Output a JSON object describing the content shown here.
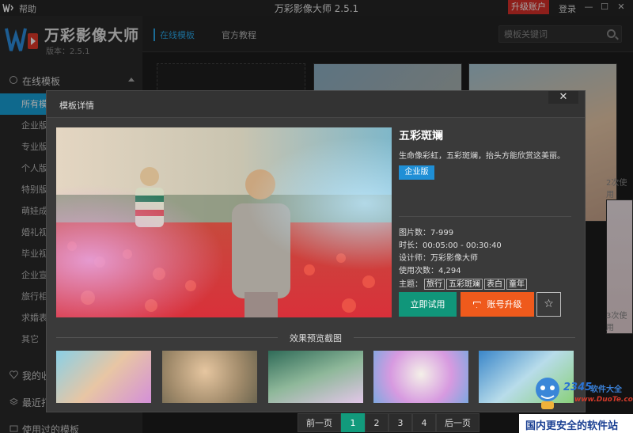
{
  "titlebar": {
    "help": "帮助",
    "title": "万彩影像大师 2.5.1",
    "upgrade": "升级账户",
    "login": "登录",
    "minimize": "—",
    "maximize": "☐",
    "close": "✕"
  },
  "sidebar": {
    "brand_name": "万彩影像大师",
    "brand_version": "版本：2.5.1",
    "online_header": "在线模板",
    "items": [
      {
        "label": "所有模"
      },
      {
        "label": "企业版"
      },
      {
        "label": "专业版"
      },
      {
        "label": "个人版"
      },
      {
        "label": "特别版"
      },
      {
        "label": "萌娃成"
      },
      {
        "label": "婚礼视"
      },
      {
        "label": "毕业视"
      },
      {
        "label": "企业宣"
      },
      {
        "label": "旅行相"
      },
      {
        "label": "求婚表"
      },
      {
        "label": "其它"
      }
    ],
    "sections": [
      {
        "label": "我的收"
      },
      {
        "label": "最近打"
      },
      {
        "label": "使用过的模板"
      }
    ]
  },
  "main": {
    "tabs": [
      {
        "label": "在线模板"
      },
      {
        "label": "官方教程"
      }
    ],
    "search": {
      "placeholder": "模板关键词"
    },
    "bg_uses": [
      "2次使用",
      "3次使用"
    ],
    "pager": {
      "prev": "前一页",
      "pages": [
        "1",
        "2",
        "3",
        "4"
      ],
      "next": "后一页"
    }
  },
  "modal": {
    "title": "模板详情",
    "close": "✕",
    "template": {
      "name": "五彩斑斓",
      "description": "生命像彩虹，五彩斑斓，抬头方能欣赏这美丽。",
      "edition": "企业版",
      "images": "图片数：7-999",
      "duration": "时长：00:05:00 - 00:30:40",
      "designer": "设计师：万彩影像大师",
      "uses": "使用次数：4,294",
      "theme_label": "主题：",
      "tags": [
        "旅行",
        "五彩斑斓",
        "表白",
        "童年"
      ]
    },
    "try_button": "立即试用",
    "upgrade_button": "账号升级",
    "fav_button": "☆",
    "preview_label": "效果预览截图"
  },
  "watermark": {
    "digits": "2345",
    "brand": "软件大全",
    "url": "www.DuoTe.com",
    "bar": "国内更安全的软件站"
  }
}
